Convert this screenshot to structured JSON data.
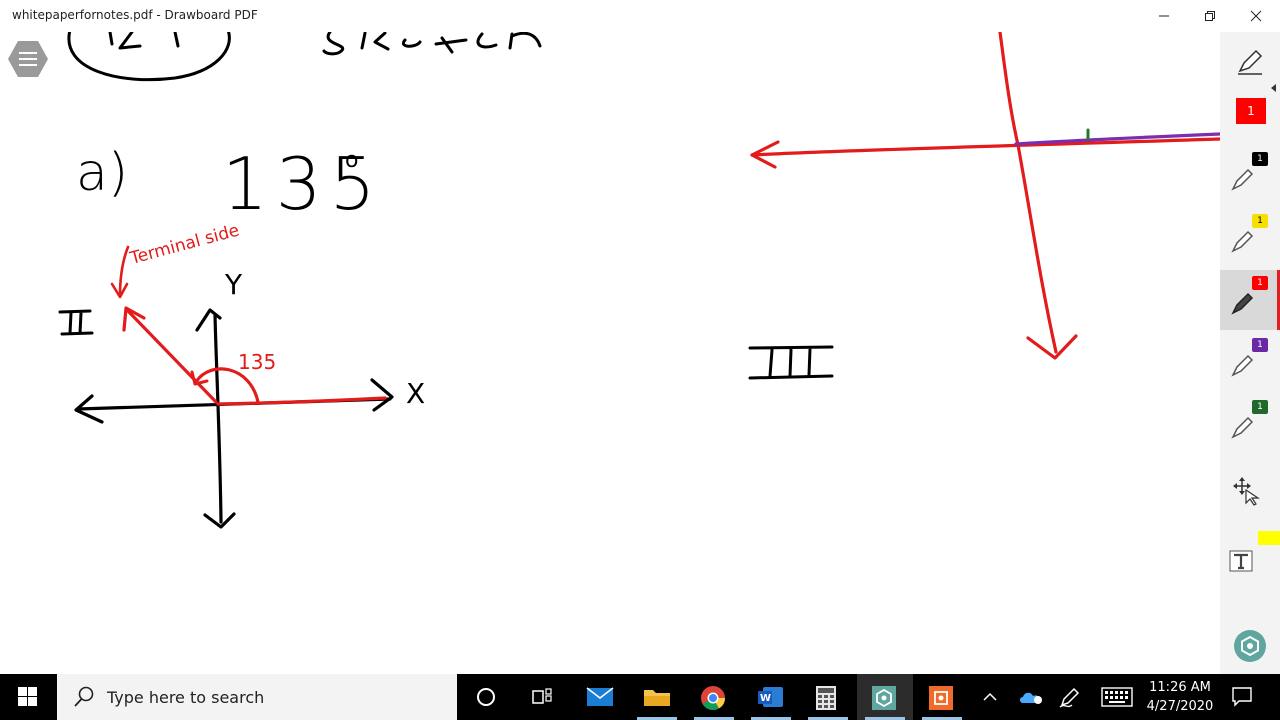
{
  "window": {
    "title": "whitepaperfornotes.pdf - Drawboard PDF"
  },
  "canvas": {
    "label_a": "a)",
    "angle_value": "135",
    "degree_symbol": "o",
    "terminal_side_label": "Terminal side",
    "quadrant_two_label": "II",
    "quadrant_three_label": "III",
    "y_axis_label": "Y",
    "x_axis_label": "X",
    "angle_arc_label": "135"
  },
  "toolbar": {
    "pens": [
      {
        "name": "pen-1",
        "badge": "1",
        "badge_color": "#ff0000",
        "selected": false
      },
      {
        "name": "pen-2",
        "badge": "1",
        "badge_color": "#000000",
        "selected": false
      },
      {
        "name": "pen-3",
        "badge": "1",
        "badge_color": "#f5e000",
        "selected": false
      },
      {
        "name": "pen-4",
        "badge": "1",
        "badge_color": "#ff0000",
        "selected": true
      },
      {
        "name": "pen-5",
        "badge": "1",
        "badge_color": "#6a2aa8",
        "selected": false
      },
      {
        "name": "pen-6",
        "badge": "1",
        "badge_color": "#1f6a2a",
        "selected": false
      }
    ],
    "text_tool_color": "#ffff00"
  },
  "taskbar": {
    "search_placeholder": "Type here to search",
    "time": "11:26 AM",
    "date": "4/27/2020"
  },
  "colors": {
    "ink_black": "#000000",
    "ink_red": "#e31b1b",
    "ink_purple": "#7a2fb0",
    "ink_green": "#1e7a2e"
  }
}
